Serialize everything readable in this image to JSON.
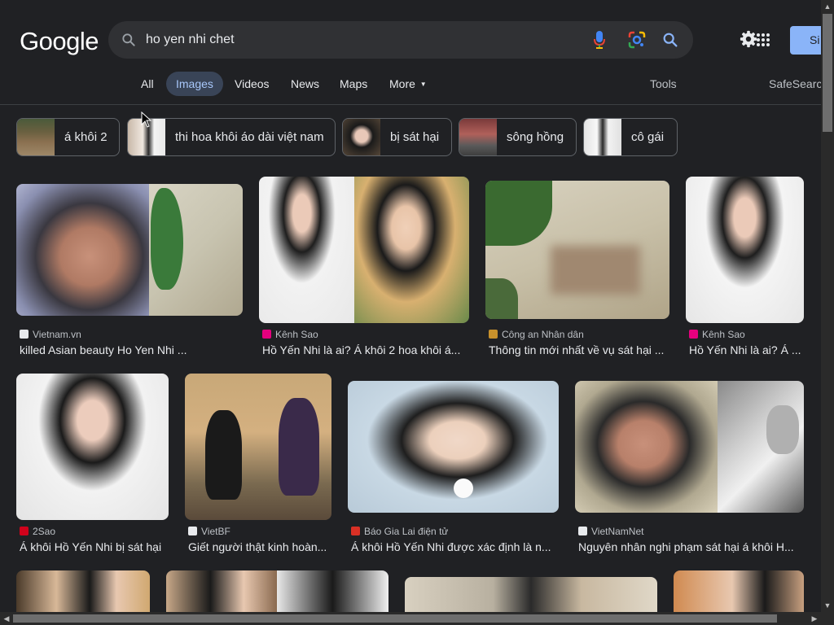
{
  "header": {
    "logo_text": "Google",
    "search_value": "ho yen nhi chet",
    "signin_label": "Si"
  },
  "tabs": {
    "all": "All",
    "images": "Images",
    "videos": "Videos",
    "news": "News",
    "maps": "Maps",
    "more": "More",
    "tools": "Tools",
    "safesearch": "SafeSearch"
  },
  "chips": [
    "á khôi 2",
    "thi hoa khôi áo dài việt nam",
    "bị sát hại",
    "sông hồng",
    "cô gái"
  ],
  "results": [
    {
      "source": "Vietnam.vn",
      "title": "killed Asian beauty Ho Yen Nhi ...",
      "fav_color": "#e8eaed"
    },
    {
      "source": "Kênh Sao",
      "title": "Hồ Yến Nhi là ai? Á khôi 2 hoa khôi á...",
      "fav_color": "#e6007e"
    },
    {
      "source": "Công an Nhân dân",
      "title": "Thông tin mới nhất về vụ sát hại ...",
      "fav_color": "#c8912c"
    },
    {
      "source": "Kênh Sao",
      "title": "Hồ Yến Nhi là ai? Á ...",
      "fav_color": "#e6007e"
    },
    {
      "source": "2Sao",
      "title": "Á khôi Hồ Yến Nhi bị sát hại",
      "fav_color": "#d0021b"
    },
    {
      "source": "VietBF",
      "title": "Giết người thật kinh hoàn...",
      "fav_color": "#e8eaed"
    },
    {
      "source": "Báo Gia Lai điện tử",
      "title": "Á khôi Hồ Yến Nhi được xác định là n...",
      "fav_color": "#d93025"
    },
    {
      "source": "VietNamNet",
      "title": "Nguyên nhân nghi phạm sát hại á khôi H...",
      "fav_color": "#e8eaed"
    }
  ],
  "colors": {
    "background": "#202124",
    "search_bg": "#303134",
    "active_tab_bg": "#394457",
    "active_tab_text": "#a8c7fa",
    "signin_bg": "#8ab4f8"
  }
}
